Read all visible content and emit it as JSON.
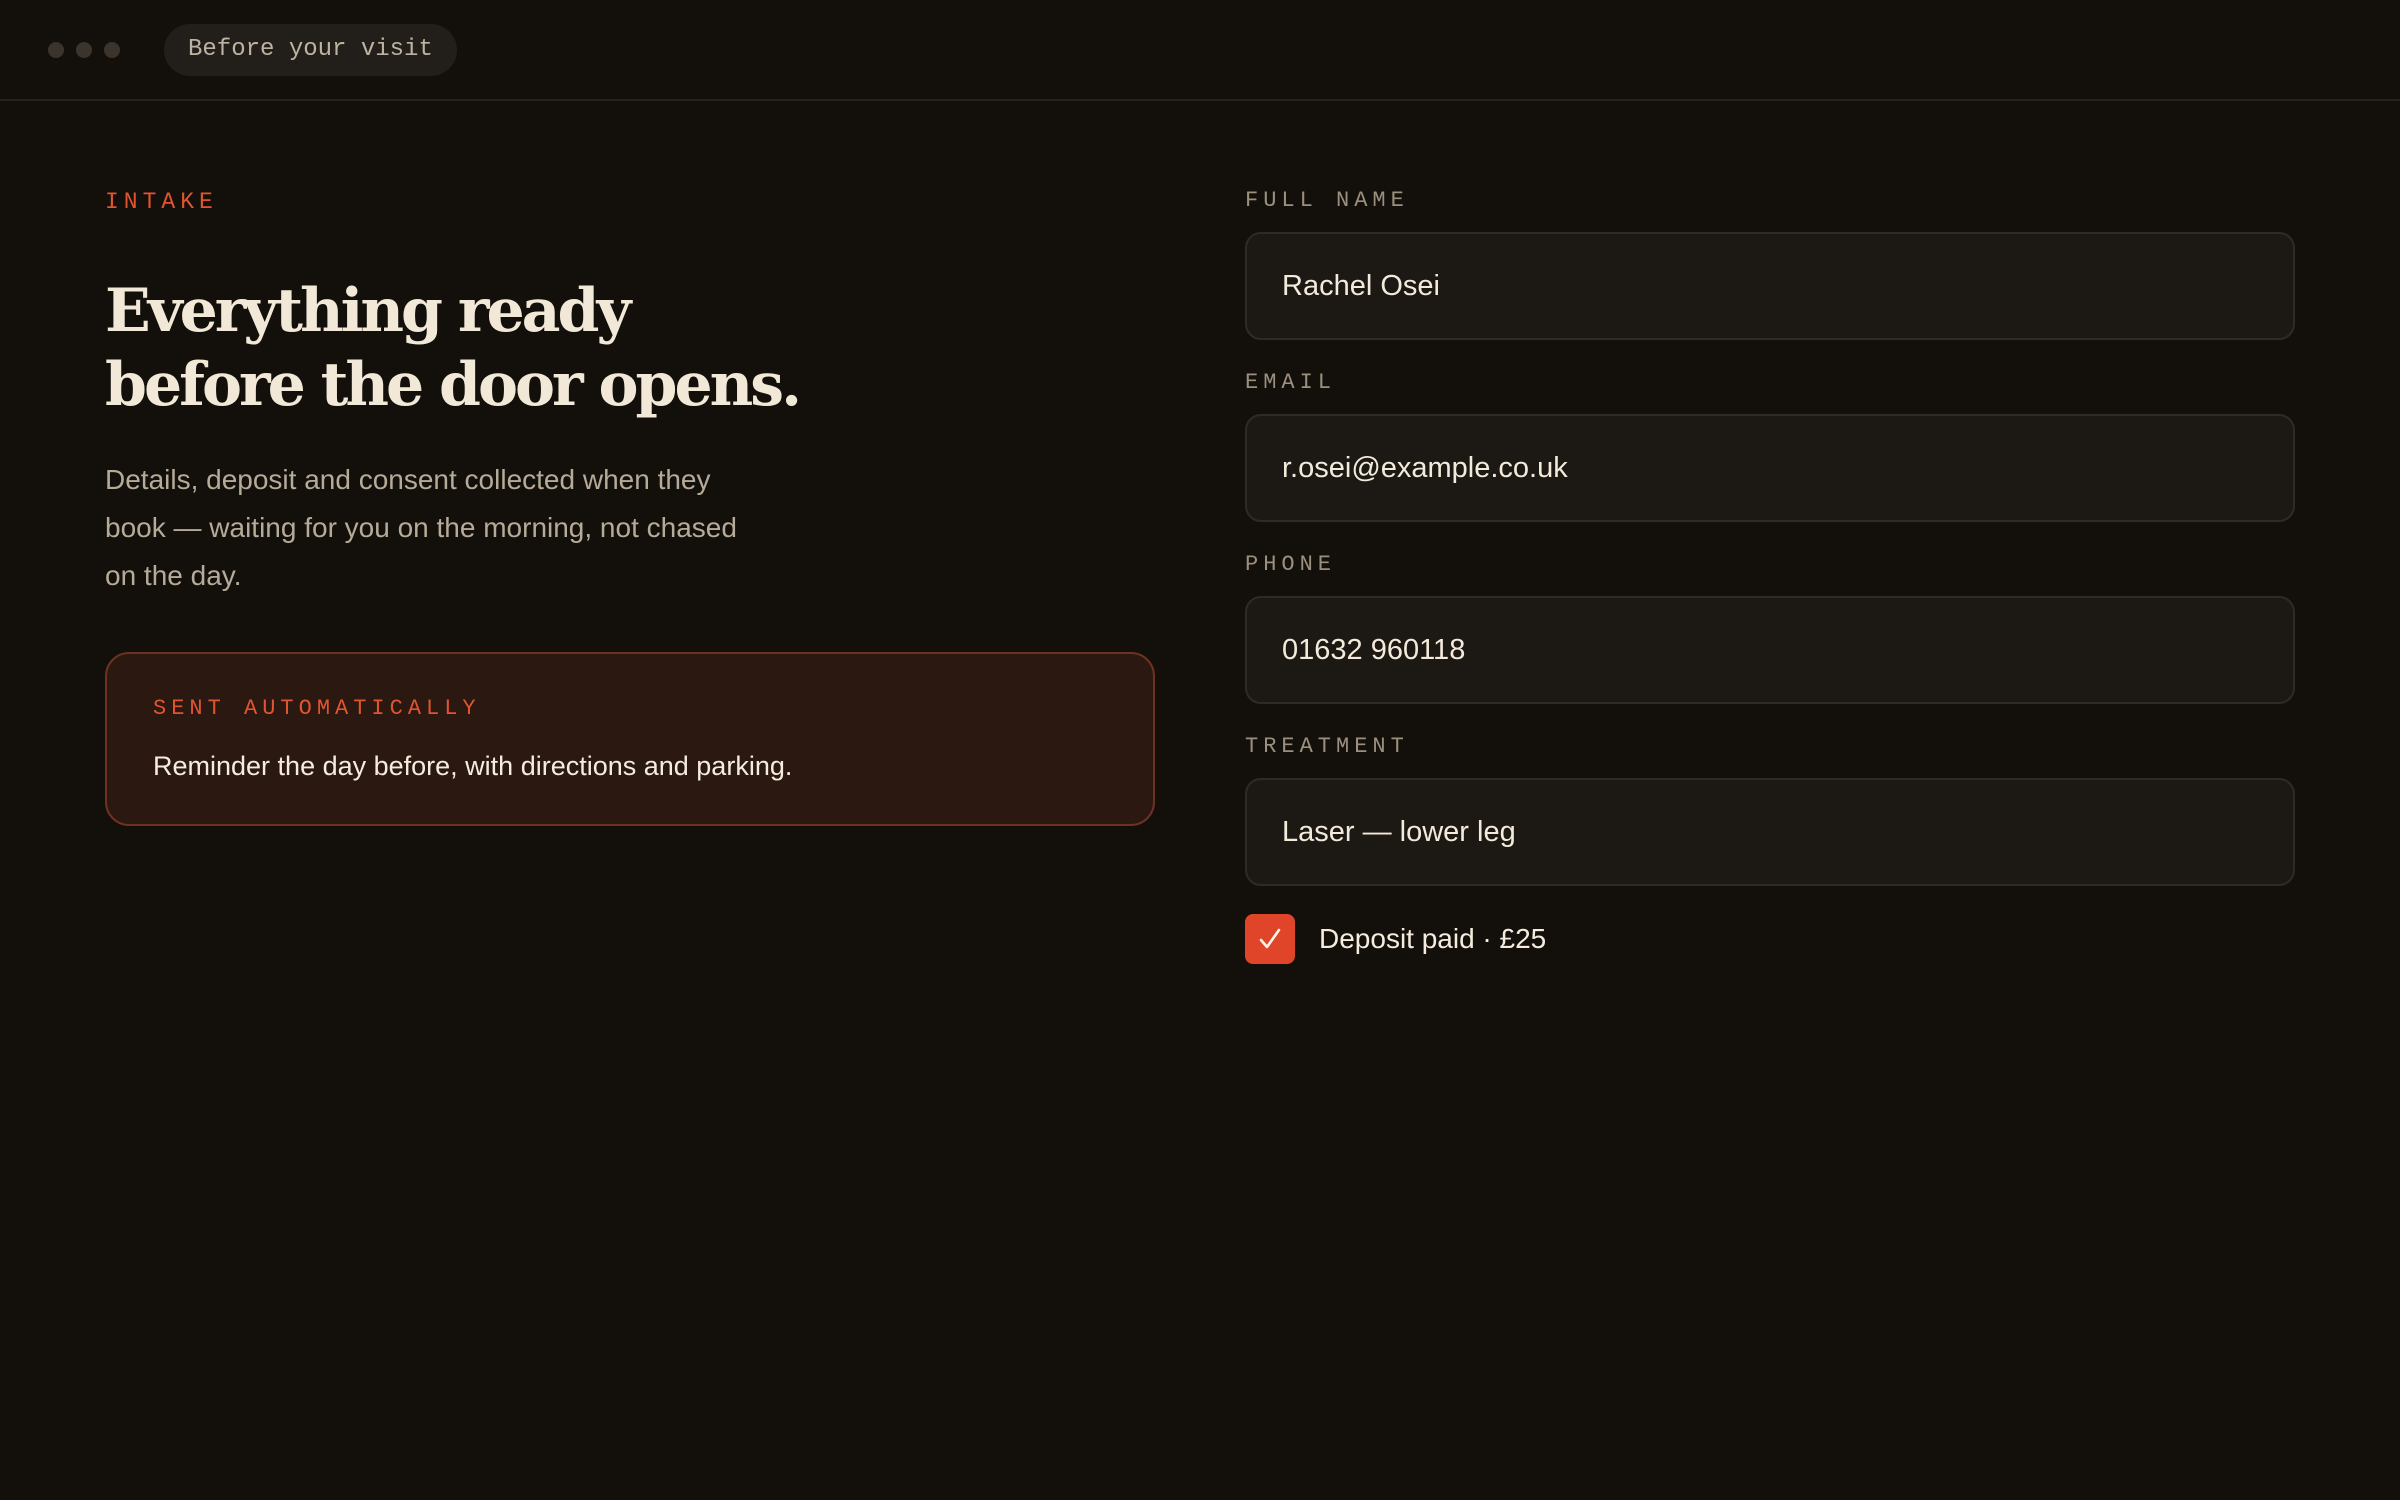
{
  "window": {
    "tab_title": "Before your visit"
  },
  "intro": {
    "eyebrow": "INTAKE",
    "headline_line1": "Everything ready",
    "headline_line2": "before the door opens.",
    "lede": "Details, deposit and consent collected when they book — waiting for you on the morning, not chased on the day."
  },
  "callout": {
    "label": "SENT AUTOMATICALLY",
    "text": "Reminder the day before, with directions and parking."
  },
  "form": {
    "full_name": {
      "label": "FULL NAME",
      "value": "Rachel Osei"
    },
    "email": {
      "label": "EMAIL",
      "value": "r.osei@example.co.uk"
    },
    "phone": {
      "label": "PHONE",
      "value": "01632 960118"
    },
    "treatment": {
      "label": "TREATMENT",
      "value": "Laser — lower leg"
    },
    "deposit": {
      "label": "Deposit paid · £25",
      "checked": true
    }
  },
  "colors": {
    "background": "#13100c",
    "accent": "#e0452a",
    "text": "#f2e8d7",
    "muted": "#9b8f7e"
  }
}
